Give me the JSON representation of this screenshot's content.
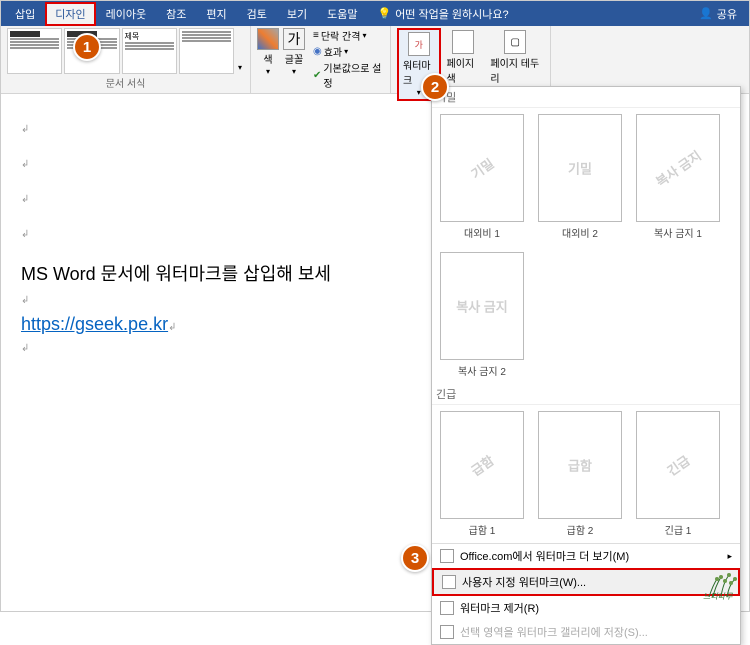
{
  "tabs": {
    "insert": "삽입",
    "design": "디자인",
    "layout": "레이아웃",
    "references": "참조",
    "mailings": "편지",
    "review": "검토",
    "view": "보기",
    "help": "도움말",
    "tell_me": "어떤 작업을 원하시나요?",
    "share": "공유"
  },
  "ribbon": {
    "doc_format_label": "문서 서식",
    "colors": "색",
    "fonts": "글꼴",
    "para_spacing": "단락 간격",
    "effects": "효과",
    "set_default": "기본값으로 설정",
    "watermark": "워터마크",
    "page_color": "페이지 색",
    "page_borders": "페이지 테두리",
    "theme_title": "제목"
  },
  "doc": {
    "line1": "MS Word 문서에 워터마크를 삽입해 보세",
    "link": "https://gseek.pe.kr"
  },
  "gallery": {
    "section1": "기밀",
    "section2": "긴급",
    "items": [
      {
        "text": "기밀",
        "label": "대외비 1",
        "rot": true
      },
      {
        "text": "기밀",
        "label": "대외비 2",
        "rot": false
      },
      {
        "text": "복사 금지",
        "label": "복사 금지 1",
        "rot": true
      },
      {
        "text": "복사 금지",
        "label": "복사 금지 2",
        "rot": false
      }
    ],
    "items2": [
      {
        "text": "급함",
        "label": "급함 1",
        "rot": true
      },
      {
        "text": "급함",
        "label": "급함 2",
        "rot": false
      },
      {
        "text": "긴급",
        "label": "긴급 1",
        "rot": true
      }
    ],
    "menu": {
      "more": "Office.com에서 워터마크 더 보기(M)",
      "custom": "사용자 지정 워터마크(W)...",
      "remove": "워터마크 제거(R)",
      "save": "선택 영역을 워터마크 갤러리에 저장(S)..."
    }
  },
  "badges": {
    "1": "1",
    "2": "2",
    "3": "3"
  }
}
